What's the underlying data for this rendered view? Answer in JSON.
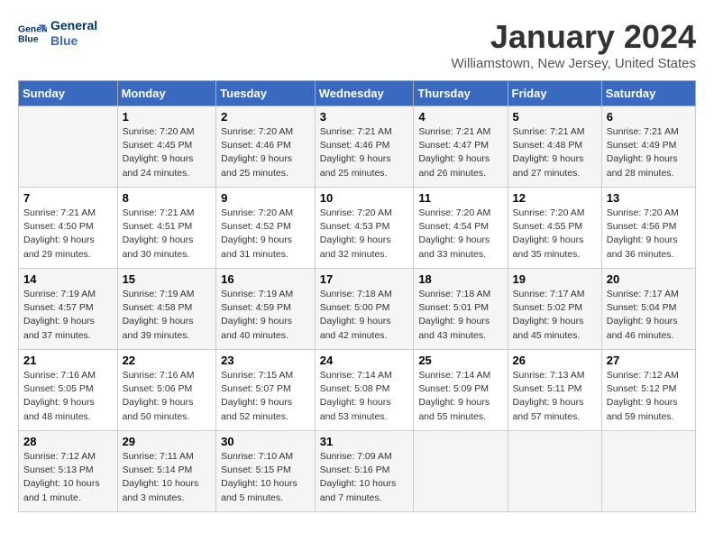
{
  "logo": {
    "line1": "General",
    "line2": "Blue"
  },
  "title": "January 2024",
  "location": "Williamstown, New Jersey, United States",
  "days_of_week": [
    "Sunday",
    "Monday",
    "Tuesday",
    "Wednesday",
    "Thursday",
    "Friday",
    "Saturday"
  ],
  "weeks": [
    [
      {
        "day": "",
        "info": ""
      },
      {
        "day": "1",
        "info": "Sunrise: 7:20 AM\nSunset: 4:45 PM\nDaylight: 9 hours\nand 24 minutes."
      },
      {
        "day": "2",
        "info": "Sunrise: 7:20 AM\nSunset: 4:46 PM\nDaylight: 9 hours\nand 25 minutes."
      },
      {
        "day": "3",
        "info": "Sunrise: 7:21 AM\nSunset: 4:46 PM\nDaylight: 9 hours\nand 25 minutes."
      },
      {
        "day": "4",
        "info": "Sunrise: 7:21 AM\nSunset: 4:47 PM\nDaylight: 9 hours\nand 26 minutes."
      },
      {
        "day": "5",
        "info": "Sunrise: 7:21 AM\nSunset: 4:48 PM\nDaylight: 9 hours\nand 27 minutes."
      },
      {
        "day": "6",
        "info": "Sunrise: 7:21 AM\nSunset: 4:49 PM\nDaylight: 9 hours\nand 28 minutes."
      }
    ],
    [
      {
        "day": "7",
        "info": "Sunrise: 7:21 AM\nSunset: 4:50 PM\nDaylight: 9 hours\nand 29 minutes."
      },
      {
        "day": "8",
        "info": "Sunrise: 7:21 AM\nSunset: 4:51 PM\nDaylight: 9 hours\nand 30 minutes."
      },
      {
        "day": "9",
        "info": "Sunrise: 7:20 AM\nSunset: 4:52 PM\nDaylight: 9 hours\nand 31 minutes."
      },
      {
        "day": "10",
        "info": "Sunrise: 7:20 AM\nSunset: 4:53 PM\nDaylight: 9 hours\nand 32 minutes."
      },
      {
        "day": "11",
        "info": "Sunrise: 7:20 AM\nSunset: 4:54 PM\nDaylight: 9 hours\nand 33 minutes."
      },
      {
        "day": "12",
        "info": "Sunrise: 7:20 AM\nSunset: 4:55 PM\nDaylight: 9 hours\nand 35 minutes."
      },
      {
        "day": "13",
        "info": "Sunrise: 7:20 AM\nSunset: 4:56 PM\nDaylight: 9 hours\nand 36 minutes."
      }
    ],
    [
      {
        "day": "14",
        "info": "Sunrise: 7:19 AM\nSunset: 4:57 PM\nDaylight: 9 hours\nand 37 minutes."
      },
      {
        "day": "15",
        "info": "Sunrise: 7:19 AM\nSunset: 4:58 PM\nDaylight: 9 hours\nand 39 minutes."
      },
      {
        "day": "16",
        "info": "Sunrise: 7:19 AM\nSunset: 4:59 PM\nDaylight: 9 hours\nand 40 minutes."
      },
      {
        "day": "17",
        "info": "Sunrise: 7:18 AM\nSunset: 5:00 PM\nDaylight: 9 hours\nand 42 minutes."
      },
      {
        "day": "18",
        "info": "Sunrise: 7:18 AM\nSunset: 5:01 PM\nDaylight: 9 hours\nand 43 minutes."
      },
      {
        "day": "19",
        "info": "Sunrise: 7:17 AM\nSunset: 5:02 PM\nDaylight: 9 hours\nand 45 minutes."
      },
      {
        "day": "20",
        "info": "Sunrise: 7:17 AM\nSunset: 5:04 PM\nDaylight: 9 hours\nand 46 minutes."
      }
    ],
    [
      {
        "day": "21",
        "info": "Sunrise: 7:16 AM\nSunset: 5:05 PM\nDaylight: 9 hours\nand 48 minutes."
      },
      {
        "day": "22",
        "info": "Sunrise: 7:16 AM\nSunset: 5:06 PM\nDaylight: 9 hours\nand 50 minutes."
      },
      {
        "day": "23",
        "info": "Sunrise: 7:15 AM\nSunset: 5:07 PM\nDaylight: 9 hours\nand 52 minutes."
      },
      {
        "day": "24",
        "info": "Sunrise: 7:14 AM\nSunset: 5:08 PM\nDaylight: 9 hours\nand 53 minutes."
      },
      {
        "day": "25",
        "info": "Sunrise: 7:14 AM\nSunset: 5:09 PM\nDaylight: 9 hours\nand 55 minutes."
      },
      {
        "day": "26",
        "info": "Sunrise: 7:13 AM\nSunset: 5:11 PM\nDaylight: 9 hours\nand 57 minutes."
      },
      {
        "day": "27",
        "info": "Sunrise: 7:12 AM\nSunset: 5:12 PM\nDaylight: 9 hours\nand 59 minutes."
      }
    ],
    [
      {
        "day": "28",
        "info": "Sunrise: 7:12 AM\nSunset: 5:13 PM\nDaylight: 10 hours\nand 1 minute."
      },
      {
        "day": "29",
        "info": "Sunrise: 7:11 AM\nSunset: 5:14 PM\nDaylight: 10 hours\nand 3 minutes."
      },
      {
        "day": "30",
        "info": "Sunrise: 7:10 AM\nSunset: 5:15 PM\nDaylight: 10 hours\nand 5 minutes."
      },
      {
        "day": "31",
        "info": "Sunrise: 7:09 AM\nSunset: 5:16 PM\nDaylight: 10 hours\nand 7 minutes."
      },
      {
        "day": "",
        "info": ""
      },
      {
        "day": "",
        "info": ""
      },
      {
        "day": "",
        "info": ""
      }
    ]
  ]
}
